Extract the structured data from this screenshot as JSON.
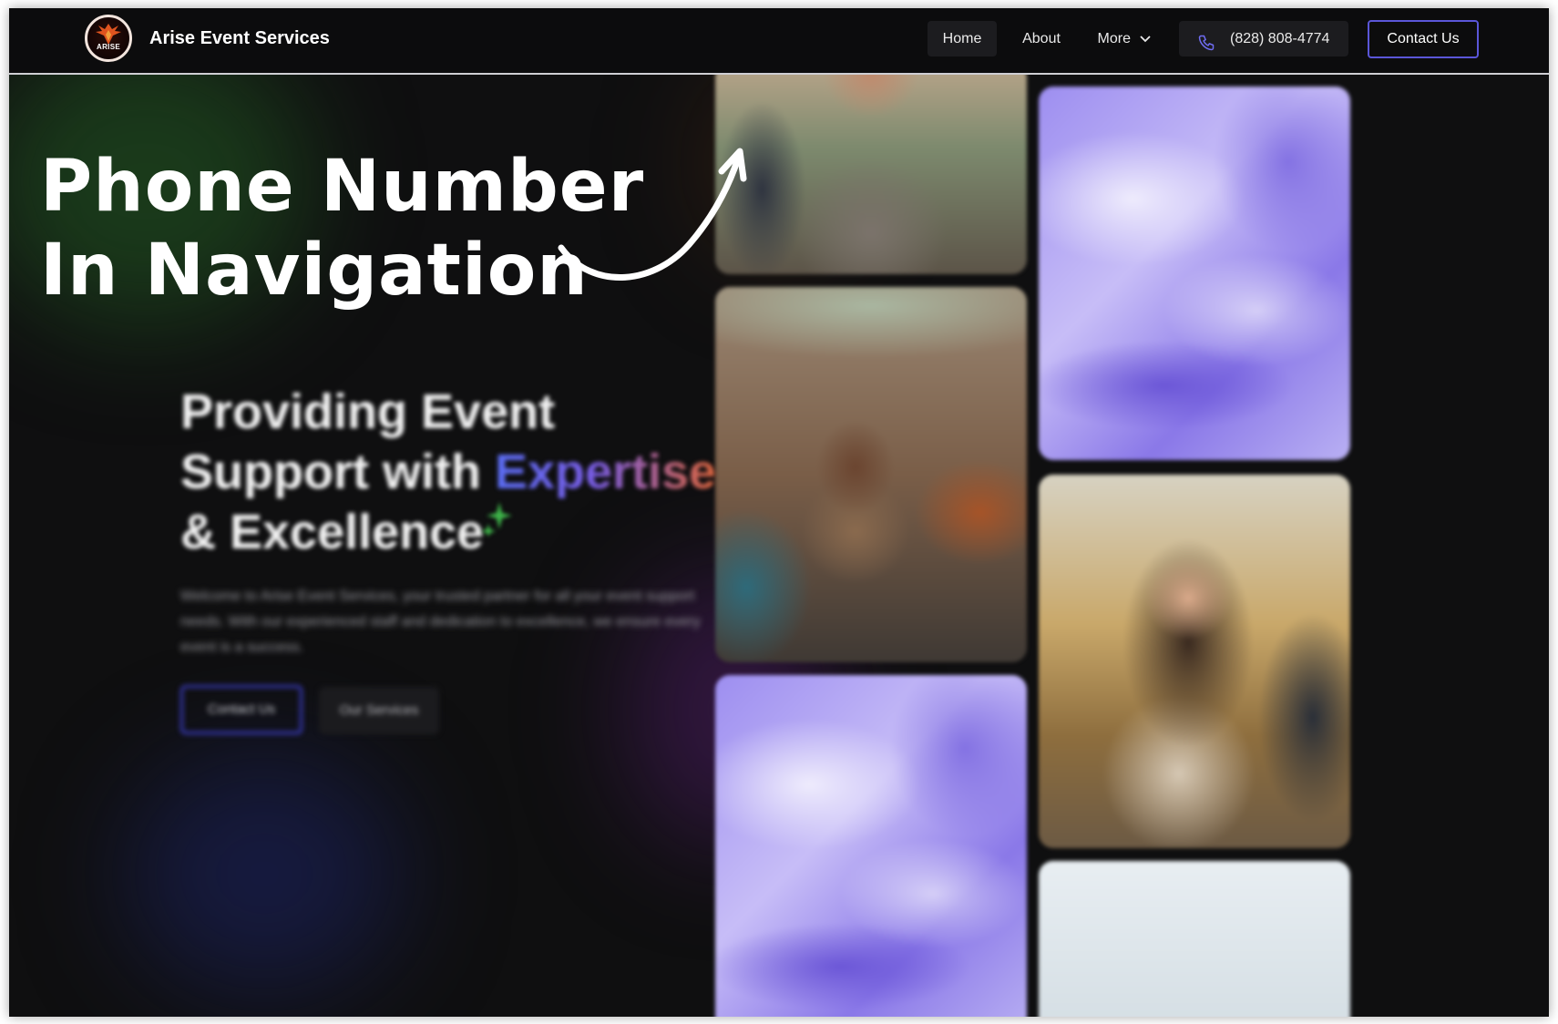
{
  "nav": {
    "logo_text": "ARISE",
    "brand": "Arise Event Services",
    "items": [
      {
        "label": "Home"
      },
      {
        "label": "About"
      },
      {
        "label": "More"
      }
    ],
    "phone": "(828) 808-4774",
    "contact_label": "Contact Us"
  },
  "annotation": {
    "line1": "Phone Number",
    "line2": "In Navigation"
  },
  "hero": {
    "title_line1": "Providing Event",
    "title_line2_plain": "Support with ",
    "title_line2_accent": "Expertise",
    "title_line3": "& Excellence",
    "description": "Welcome to Arise Event Services, your trusted partner for all your event support needs. With our experienced staff and dedication to excellence, we ensure every event is a success.",
    "primary_button": "Contact Us",
    "secondary_button": "Our Services"
  },
  "colors": {
    "accent_purple": "#5a56d8",
    "background": "#0f0f10",
    "accent_gradient_start": "#5b6ef5",
    "accent_gradient_end": "#e0673e"
  },
  "icons": [
    "phone-icon",
    "chevron-down-icon",
    "arrow-icon",
    "sparkle-icon"
  ]
}
